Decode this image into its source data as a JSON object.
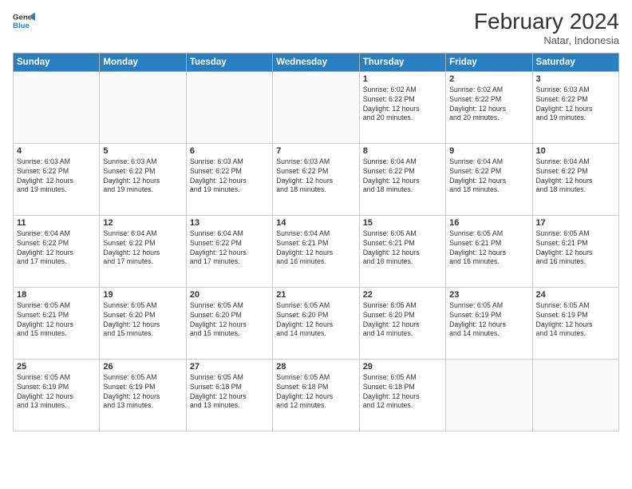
{
  "header": {
    "logo_line1": "General",
    "logo_line2": "Blue",
    "month": "February 2024",
    "location": "Natar, Indonesia"
  },
  "days_of_week": [
    "Sunday",
    "Monday",
    "Tuesday",
    "Wednesday",
    "Thursday",
    "Friday",
    "Saturday"
  ],
  "weeks": [
    [
      {
        "day": "",
        "info": ""
      },
      {
        "day": "",
        "info": ""
      },
      {
        "day": "",
        "info": ""
      },
      {
        "day": "",
        "info": ""
      },
      {
        "day": "1",
        "info": "Sunrise: 6:02 AM\nSunset: 6:22 PM\nDaylight: 12 hours\nand 20 minutes."
      },
      {
        "day": "2",
        "info": "Sunrise: 6:02 AM\nSunset: 6:22 PM\nDaylight: 12 hours\nand 20 minutes."
      },
      {
        "day": "3",
        "info": "Sunrise: 6:03 AM\nSunset: 6:22 PM\nDaylight: 12 hours\nand 19 minutes."
      }
    ],
    [
      {
        "day": "4",
        "info": "Sunrise: 6:03 AM\nSunset: 6:22 PM\nDaylight: 12 hours\nand 19 minutes."
      },
      {
        "day": "5",
        "info": "Sunrise: 6:03 AM\nSunset: 6:22 PM\nDaylight: 12 hours\nand 19 minutes."
      },
      {
        "day": "6",
        "info": "Sunrise: 6:03 AM\nSunset: 6:22 PM\nDaylight: 12 hours\nand 19 minutes."
      },
      {
        "day": "7",
        "info": "Sunrise: 6:03 AM\nSunset: 6:22 PM\nDaylight: 12 hours\nand 18 minutes."
      },
      {
        "day": "8",
        "info": "Sunrise: 6:04 AM\nSunset: 6:22 PM\nDaylight: 12 hours\nand 18 minutes."
      },
      {
        "day": "9",
        "info": "Sunrise: 6:04 AM\nSunset: 6:22 PM\nDaylight: 12 hours\nand 18 minutes."
      },
      {
        "day": "10",
        "info": "Sunrise: 6:04 AM\nSunset: 6:22 PM\nDaylight: 12 hours\nand 18 minutes."
      }
    ],
    [
      {
        "day": "11",
        "info": "Sunrise: 6:04 AM\nSunset: 6:22 PM\nDaylight: 12 hours\nand 17 minutes."
      },
      {
        "day": "12",
        "info": "Sunrise: 6:04 AM\nSunset: 6:22 PM\nDaylight: 12 hours\nand 17 minutes."
      },
      {
        "day": "13",
        "info": "Sunrise: 6:04 AM\nSunset: 6:22 PM\nDaylight: 12 hours\nand 17 minutes."
      },
      {
        "day": "14",
        "info": "Sunrise: 6:04 AM\nSunset: 6:21 PM\nDaylight: 12 hours\nand 16 minutes."
      },
      {
        "day": "15",
        "info": "Sunrise: 6:05 AM\nSunset: 6:21 PM\nDaylight: 12 hours\nand 16 minutes."
      },
      {
        "day": "16",
        "info": "Sunrise: 6:05 AM\nSunset: 6:21 PM\nDaylight: 12 hours\nand 16 minutes."
      },
      {
        "day": "17",
        "info": "Sunrise: 6:05 AM\nSunset: 6:21 PM\nDaylight: 12 hours\nand 16 minutes."
      }
    ],
    [
      {
        "day": "18",
        "info": "Sunrise: 6:05 AM\nSunset: 6:21 PM\nDaylight: 12 hours\nand 15 minutes."
      },
      {
        "day": "19",
        "info": "Sunrise: 6:05 AM\nSunset: 6:20 PM\nDaylight: 12 hours\nand 15 minutes."
      },
      {
        "day": "20",
        "info": "Sunrise: 6:05 AM\nSunset: 6:20 PM\nDaylight: 12 hours\nand 15 minutes."
      },
      {
        "day": "21",
        "info": "Sunrise: 6:05 AM\nSunset: 6:20 PM\nDaylight: 12 hours\nand 14 minutes."
      },
      {
        "day": "22",
        "info": "Sunrise: 6:05 AM\nSunset: 6:20 PM\nDaylight: 12 hours\nand 14 minutes."
      },
      {
        "day": "23",
        "info": "Sunrise: 6:05 AM\nSunset: 6:19 PM\nDaylight: 12 hours\nand 14 minutes."
      },
      {
        "day": "24",
        "info": "Sunrise: 6:05 AM\nSunset: 6:19 PM\nDaylight: 12 hours\nand 14 minutes."
      }
    ],
    [
      {
        "day": "25",
        "info": "Sunrise: 6:05 AM\nSunset: 6:19 PM\nDaylight: 12 hours\nand 13 minutes."
      },
      {
        "day": "26",
        "info": "Sunrise: 6:05 AM\nSunset: 6:19 PM\nDaylight: 12 hours\nand 13 minutes."
      },
      {
        "day": "27",
        "info": "Sunrise: 6:05 AM\nSunset: 6:18 PM\nDaylight: 12 hours\nand 13 minutes."
      },
      {
        "day": "28",
        "info": "Sunrise: 6:05 AM\nSunset: 6:18 PM\nDaylight: 12 hours\nand 12 minutes."
      },
      {
        "day": "29",
        "info": "Sunrise: 6:05 AM\nSunset: 6:18 PM\nDaylight: 12 hours\nand 12 minutes."
      },
      {
        "day": "",
        "info": ""
      },
      {
        "day": "",
        "info": ""
      }
    ]
  ]
}
